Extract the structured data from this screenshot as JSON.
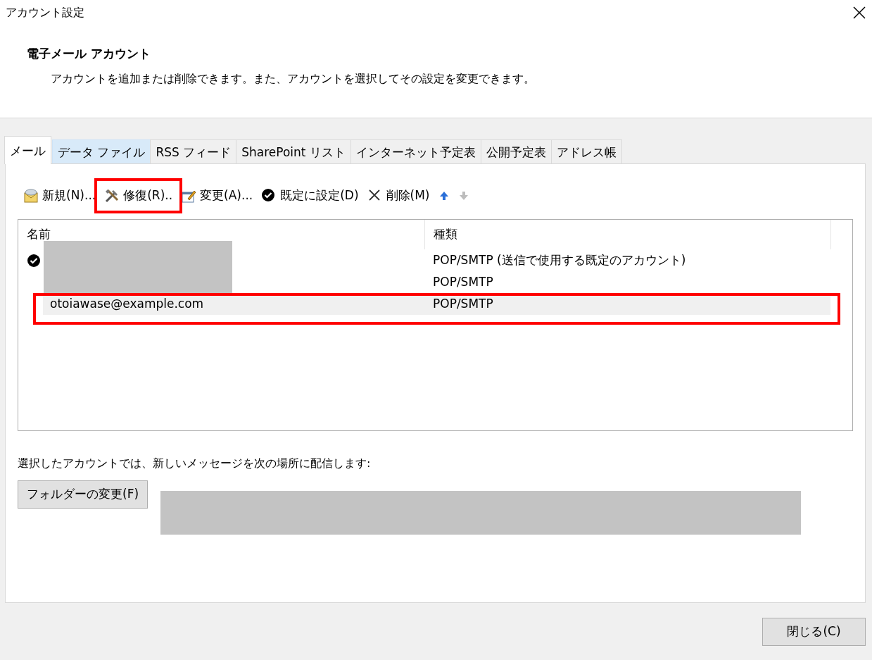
{
  "window": {
    "title": "アカウント設定"
  },
  "header": {
    "title": "電子メール アカウント",
    "description": "アカウントを追加または削除できます。また、アカウントを選択してその設定を変更できます。"
  },
  "tabs": [
    {
      "label": "メール",
      "selected": true,
      "hover": false
    },
    {
      "label": "データ ファイル",
      "selected": false,
      "hover": true
    },
    {
      "label": "RSS フィード",
      "selected": false,
      "hover": false
    },
    {
      "label": "SharePoint リスト",
      "selected": false,
      "hover": false
    },
    {
      "label": "インターネット予定表",
      "selected": false,
      "hover": false
    },
    {
      "label": "公開予定表",
      "selected": false,
      "hover": false
    },
    {
      "label": "アドレス帳",
      "selected": false,
      "hover": false
    }
  ],
  "toolbar": [
    {
      "kind": "new",
      "label": "新規(N)...",
      "disabled": false,
      "highlighted": false
    },
    {
      "kind": "repair",
      "label": "修復(R)..",
      "disabled": false,
      "highlighted": true
    },
    {
      "kind": "change",
      "label": "変更(A)...",
      "disabled": false,
      "highlighted": false
    },
    {
      "kind": "default",
      "label": "既定に設定(D)",
      "disabled": false,
      "highlighted": false
    },
    {
      "kind": "delete",
      "label": "削除(M)",
      "disabled": false,
      "highlighted": false
    },
    {
      "kind": "up",
      "disabled": false,
      "highlighted": false
    },
    {
      "kind": "down",
      "disabled": true,
      "highlighted": false
    }
  ],
  "accounts": {
    "columns": [
      "名前",
      "種類"
    ],
    "rows": [
      {
        "type": "POP/SMTP (送信で使用する既定のアカウント)",
        "default": true,
        "name_hidden": true,
        "selected": false,
        "highlighted": false
      },
      {
        "type": "POP/SMTP",
        "default": false,
        "name_hidden": true,
        "selected": false,
        "highlighted": false
      },
      {
        "name": "otoiawase@example.com",
        "type": "POP/SMTP",
        "default": false,
        "name_hidden": false,
        "selected": true,
        "highlighted": true
      }
    ]
  },
  "delivery": {
    "label": "選択したアカウントでは、新しいメッセージを次の場所に配信します:",
    "button": "フォルダーの変更(F)",
    "path_hidden": true
  },
  "footer": {
    "close_button": "閉じる(C)"
  }
}
